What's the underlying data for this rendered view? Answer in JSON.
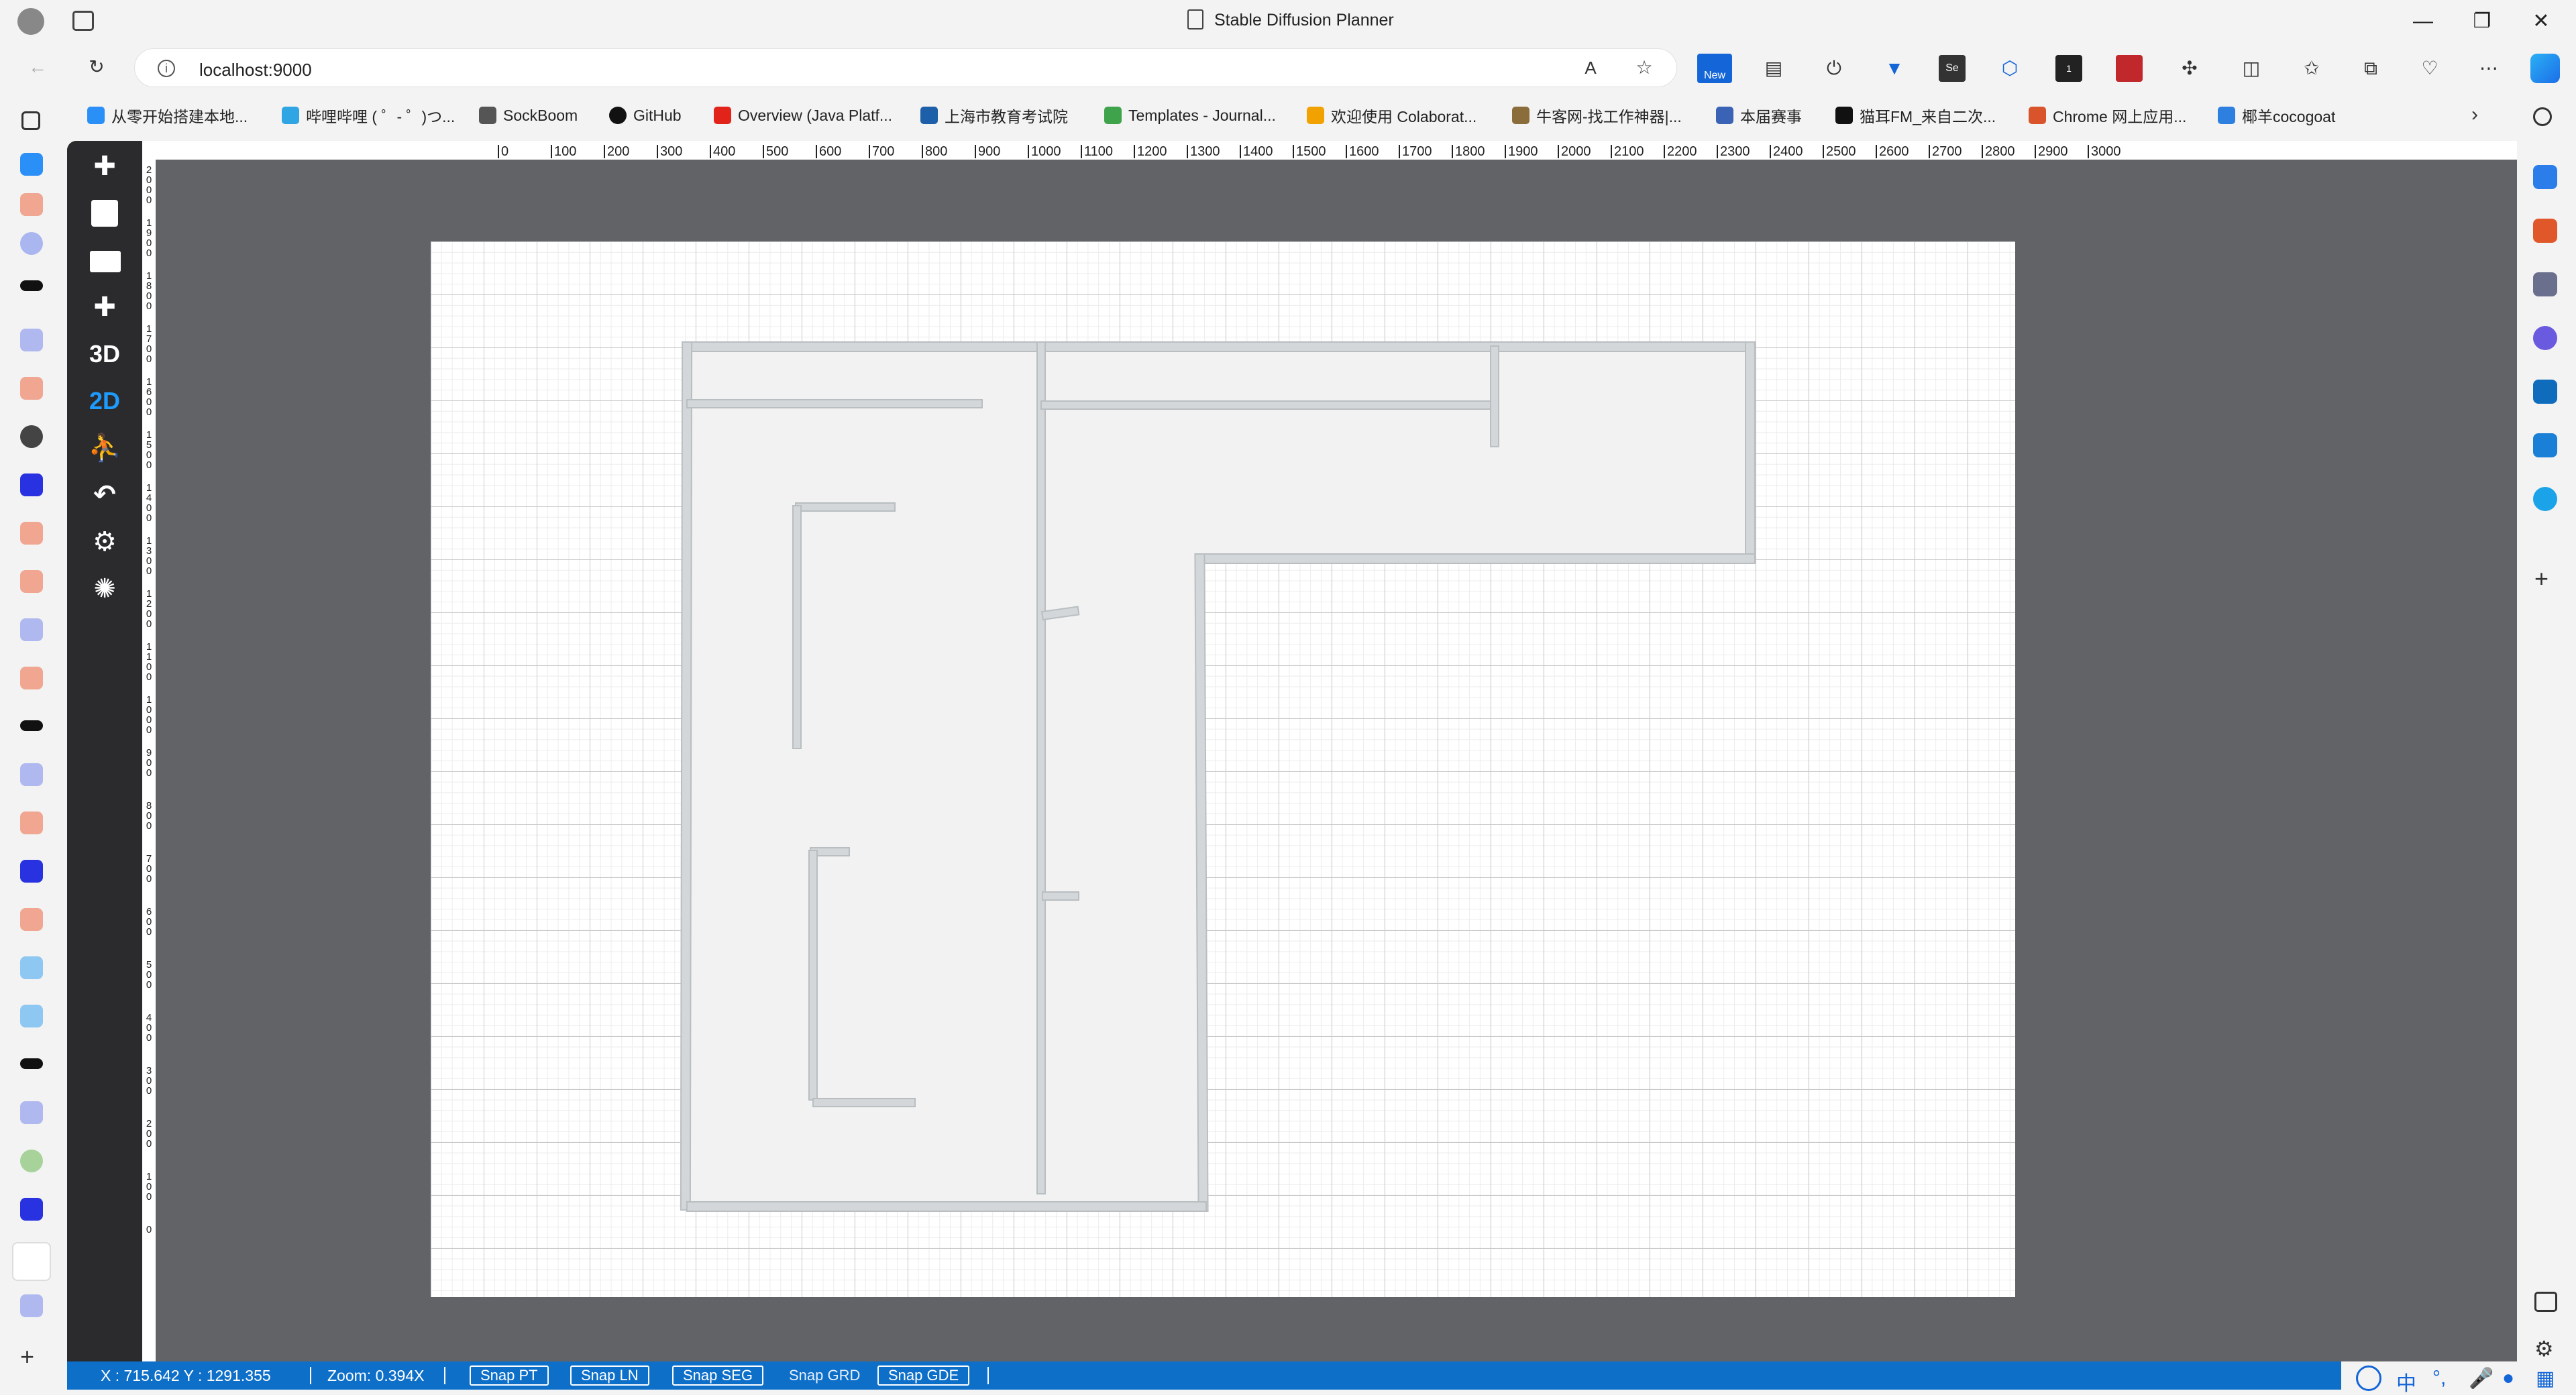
{
  "window": {
    "title": "Stable Diffusion Planner",
    "minimize": "—",
    "restore": "❐",
    "close": "✕"
  },
  "browser": {
    "url": "localhost:9000",
    "new_badge": "New",
    "ext_badge": "1"
  },
  "bookmarks": [
    {
      "label": "从零开始搭建本地...",
      "color": "#2a8ff7"
    },
    {
      "label": "哔哩哔哩 ( ゜- ゜)つ...",
      "color": "#2fa6e3"
    },
    {
      "label": "SockBoom",
      "color": "#555555"
    },
    {
      "label": "GitHub",
      "color": "#111111"
    },
    {
      "label": "Overview (Java Platf...",
      "color": "#e2231a"
    },
    {
      "label": "上海市教育考试院",
      "color": "#1d5fa8"
    },
    {
      "label": "Templates - Journal...",
      "color": "#3ea34a"
    },
    {
      "label": "欢迎使用 Colaborat...",
      "color": "#f2a200"
    },
    {
      "label": "牛客网-找工作神器|...",
      "color": "#8a6d3b"
    },
    {
      "label": "本届赛事",
      "color": "#3a62b5"
    },
    {
      "label": "猫耳FM_来自二次...",
      "color": "#111111"
    },
    {
      "label": "Chrome 网上应用...",
      "color": "#d9542b"
    },
    {
      "label": "椰羊cocogoat",
      "color": "#2d7fe0"
    }
  ],
  "tools": [
    {
      "name": "add-icon",
      "glyph": "✚"
    },
    {
      "name": "save-icon",
      "glyph": "💾"
    },
    {
      "name": "open-folder-icon",
      "glyph": "📂"
    },
    {
      "name": "new-icon",
      "glyph": "✚"
    },
    {
      "name": "view-3d",
      "glyph": "3D"
    },
    {
      "name": "view-2d",
      "glyph": "2D"
    },
    {
      "name": "walk-icon",
      "glyph": "🚶"
    },
    {
      "name": "undo-icon",
      "glyph": "↶"
    },
    {
      "name": "settings-icon",
      "glyph": "⚙"
    },
    {
      "name": "camera-icon",
      "glyph": "✺"
    }
  ],
  "ruler": {
    "h_ticks": [
      "0",
      "100",
      "200",
      "300",
      "400",
      "500",
      "600",
      "700",
      "800",
      "900",
      "1000",
      "1100",
      "1200",
      "1300",
      "1400",
      "1500",
      "1600",
      "1700",
      "1800",
      "1900",
      "2000",
      "2100",
      "2200",
      "2300",
      "2400",
      "2500",
      "2600",
      "2700",
      "2800",
      "2900",
      "3000"
    ],
    "v_ticks": [
      "2000",
      "1900",
      "1800",
      "1700",
      "1600",
      "1500",
      "1400",
      "1300",
      "1200",
      "1100",
      "1000",
      "900",
      "800",
      "700",
      "600",
      "500",
      "400",
      "300",
      "200",
      "100",
      "0"
    ]
  },
  "status": {
    "coords": "X : 715.642   Y : 1291.355",
    "zoom": "Zoom: 0.394X",
    "snap_pt": "Snap PT",
    "snap_ln": "Snap LN",
    "snap_seg": "Snap SEG",
    "snap_grd": "Snap GRD",
    "snap_gde": "Snap GDE"
  },
  "ime": {
    "lang": "中"
  },
  "colors": {
    "accent": "#1e9bff",
    "statusbar": "#0e6fc9",
    "wall": "#d3d7d9",
    "wall_stroke": "#b9bec1",
    "floor": "#f2f2f2"
  }
}
